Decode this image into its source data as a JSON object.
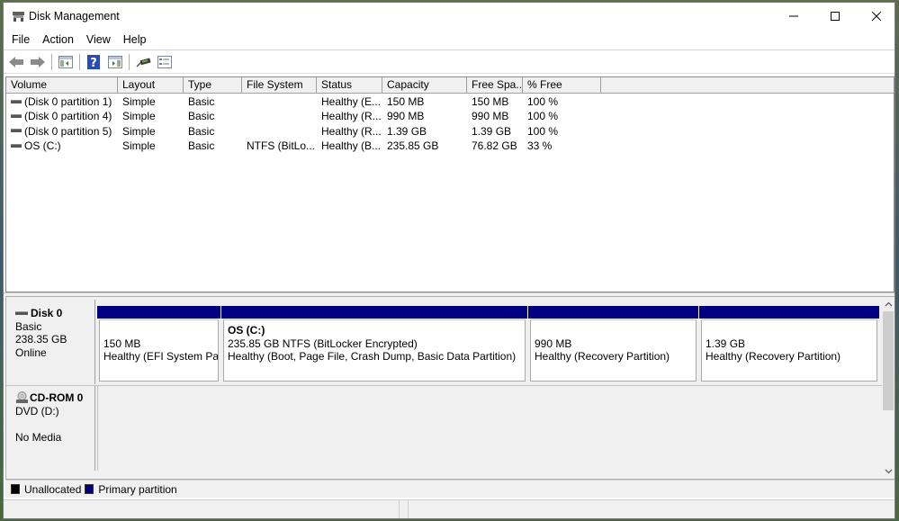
{
  "window": {
    "title": "Disk Management",
    "controls": {
      "minimize": "minimize",
      "maximize": "maximize",
      "close": "close"
    }
  },
  "menu": {
    "items": [
      {
        "label": "File"
      },
      {
        "label": "Action"
      },
      {
        "label": "View"
      },
      {
        "label": "Help"
      }
    ]
  },
  "toolbar": {
    "buttons": [
      {
        "icon": "back-arrow-icon"
      },
      {
        "icon": "forward-arrow-icon"
      },
      {
        "icon": "show-hide-console-tree-icon"
      },
      {
        "icon": "help-icon"
      },
      {
        "icon": "show-hide-action-pane-icon"
      },
      {
        "icon": "connect-drive-icon"
      },
      {
        "icon": "properties-list-icon"
      }
    ]
  },
  "volume_list": {
    "columns": [
      "Volume",
      "Layout",
      "Type",
      "File System",
      "Status",
      "Capacity",
      "Free Spa...",
      "% Free"
    ],
    "rows": [
      {
        "volume": "(Disk 0 partition 1)",
        "layout": "Simple",
        "type": "Basic",
        "fs": "",
        "status": "Healthy (E...",
        "capacity": "150 MB",
        "free": "150 MB",
        "pct": "100 %"
      },
      {
        "volume": "(Disk 0 partition 4)",
        "layout": "Simple",
        "type": "Basic",
        "fs": "",
        "status": "Healthy (R...",
        "capacity": "990 MB",
        "free": "990 MB",
        "pct": "100 %"
      },
      {
        "volume": "(Disk 0 partition 5)",
        "layout": "Simple",
        "type": "Basic",
        "fs": "",
        "status": "Healthy (R...",
        "capacity": "1.39 GB",
        "free": "1.39 GB",
        "pct": "100 %"
      },
      {
        "volume": "OS (C:)",
        "layout": "Simple",
        "type": "Basic",
        "fs": "NTFS (BitLo...",
        "status": "Healthy (B...",
        "capacity": "235.85 GB",
        "free": "76.82 GB",
        "pct": "33 %"
      }
    ]
  },
  "disks": [
    {
      "name": "Disk 0",
      "type": "Basic",
      "size": "238.35 GB",
      "status": "Online",
      "partitions": [
        {
          "title": "",
          "line1": "150 MB",
          "line2": "Healthy (EFI System Part"
        },
        {
          "title": "OS  (C:)",
          "line1": "235.85 GB NTFS (BitLocker Encrypted)",
          "line2": "Healthy (Boot, Page File, Crash Dump, Basic Data Partition)"
        },
        {
          "title": "",
          "line1": "990 MB",
          "line2": "Healthy (Recovery Partition)"
        },
        {
          "title": "",
          "line1": "1.39 GB",
          "line2": "Healthy (Recovery Partition)"
        }
      ]
    },
    {
      "name": "CD-ROM 0",
      "type": "DVD (D:)",
      "size": "",
      "status": "No Media"
    }
  ],
  "legend": {
    "items": [
      {
        "label": "Unallocated",
        "color": "#000000"
      },
      {
        "label": "Primary partition",
        "color": "#000080"
      }
    ]
  },
  "colors": {
    "primary_partition": "#000080",
    "unallocated": "#000000"
  }
}
